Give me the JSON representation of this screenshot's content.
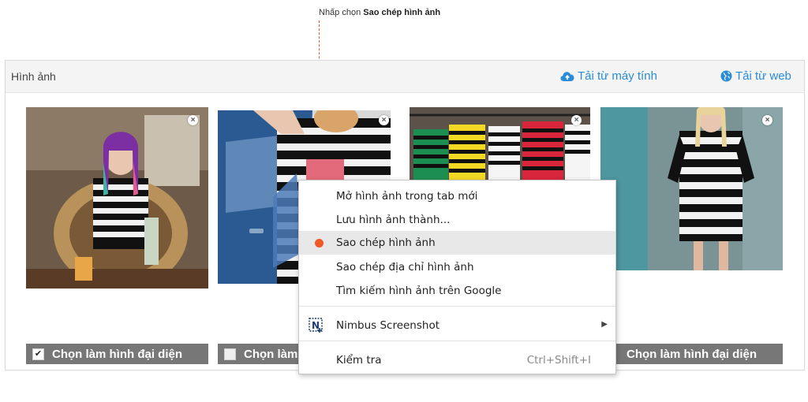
{
  "annotation": {
    "prefix": "Nhấp chọn ",
    "bold": "Sao chép hình ảnh"
  },
  "panel": {
    "title": "Hình ảnh",
    "upload_label": "Tải từ máy tính",
    "web_label": "Tải từ web",
    "icons": {
      "upload": "cloud-upload-icon",
      "web": "globe-icon"
    },
    "accent_color": "#2a8bd7"
  },
  "photos": [
    {
      "name": "photo-1",
      "remove": "×",
      "select_label": "Chọn làm hình đại diện",
      "checked": true
    },
    {
      "name": "photo-2",
      "remove": "×",
      "select_label": "Chọn làm",
      "checked": false
    },
    {
      "name": "photo-3",
      "remove": "×",
      "select_label": "",
      "checked": false
    },
    {
      "name": "photo-4",
      "remove": "×",
      "select_label": "Chọn làm hình đại diện",
      "checked": false
    }
  ],
  "context_menu": {
    "items": [
      {
        "label": "Mở hình ảnh trong tab mới"
      },
      {
        "label": "Lưu hình ảnh thành..."
      },
      {
        "label": "Sao chép hình ảnh",
        "highlighted": true
      },
      {
        "label": "Sao chép địa chỉ hình ảnh"
      },
      {
        "label": "Tìm kiếm hình ảnh trên Google"
      },
      {
        "label": "Nimbus Screenshot",
        "icon": "nimbus-icon",
        "submenu": "▶"
      },
      {
        "label": "Kiểm tra",
        "shortcut": "Ctrl+Shift+I"
      }
    ],
    "highlight_marker_color": "#f05a28"
  }
}
